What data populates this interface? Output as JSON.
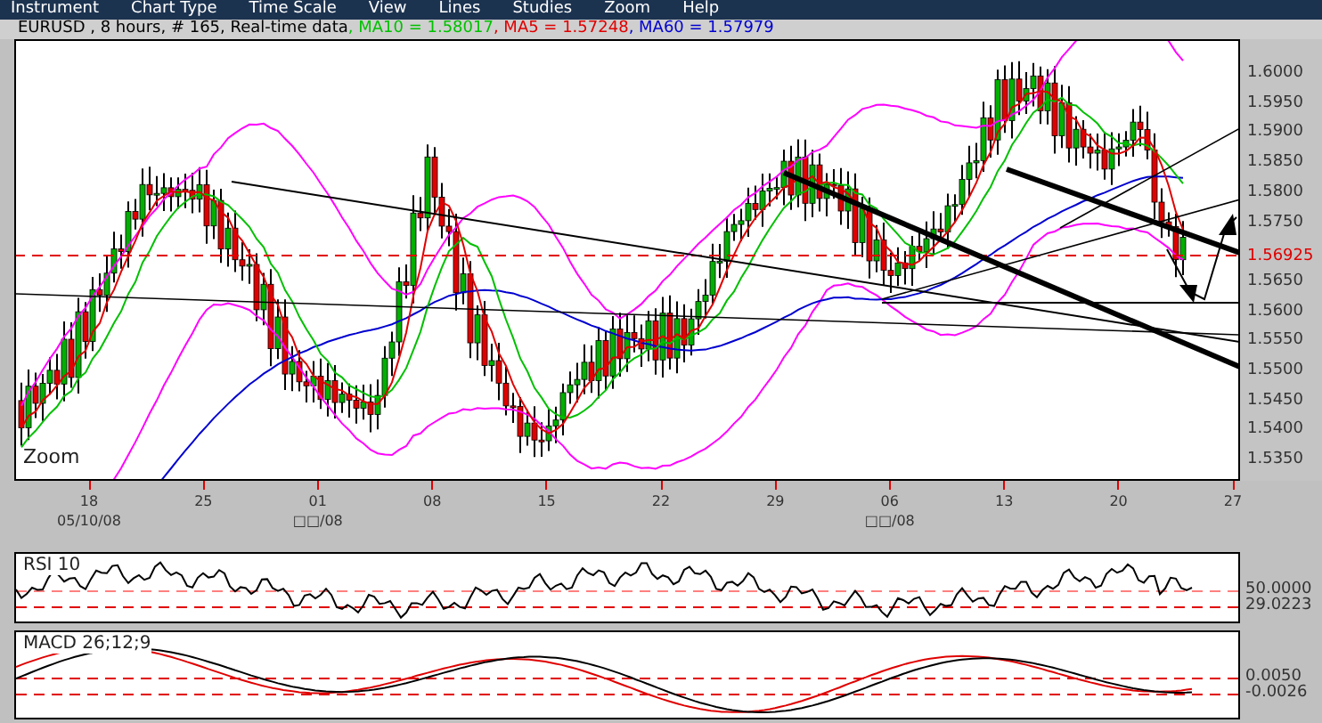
{
  "menu": [
    {
      "label": "Instrument"
    },
    {
      "label": "Chart Type"
    },
    {
      "label": "Time Scale"
    },
    {
      "label": "View"
    },
    {
      "label": "Lines"
    },
    {
      "label": "Studies"
    },
    {
      "label": "Zoom"
    },
    {
      "label": "Help"
    }
  ],
  "legend": [
    {
      "text": "EURUSD , 8 hours, # 165, Real-time data",
      "color": "#000000"
    },
    {
      "text": ", MA10 = 1.58017",
      "color": "#00c000"
    },
    {
      "text": ", MA5 = 1.57248",
      "color": "#e00000"
    },
    {
      "text": ", MA60 = 1.57979",
      "color": "#0000d0"
    }
  ],
  "price_chart": {
    "zoom_label": "Zoom",
    "price_axis": [
      {
        "label": "1.6000",
        "kind": "tick"
      },
      {
        "label": "1.5950",
        "kind": "tick"
      },
      {
        "label": "1.5900",
        "kind": "tick"
      },
      {
        "label": "1.5850",
        "kind": "tick"
      },
      {
        "label": "1.5800",
        "kind": "tick"
      },
      {
        "label": "1.5750",
        "kind": "tick"
      },
      {
        "label": "1.56925",
        "kind": "current"
      },
      {
        "label": "1.5650",
        "kind": "tick"
      },
      {
        "label": "1.5600",
        "kind": "tick"
      },
      {
        "label": "1.5550",
        "kind": "tick"
      },
      {
        "label": "1.5500",
        "kind": "tick"
      },
      {
        "label": "1.5450",
        "kind": "tick"
      },
      {
        "label": "1.5400",
        "kind": "tick"
      },
      {
        "label": "1.5350",
        "kind": "tick"
      }
    ]
  },
  "date_axis": [
    {
      "day": "18",
      "month": "05/10/08"
    },
    {
      "day": "25"
    },
    {
      "day": "01",
      "month": "□□/08"
    },
    {
      "day": "08"
    },
    {
      "day": "15"
    },
    {
      "day": "22"
    },
    {
      "day": "29"
    },
    {
      "day": "06",
      "month": "□□/08"
    },
    {
      "day": "13"
    },
    {
      "day": "20"
    },
    {
      "day": "27"
    }
  ],
  "rsi": {
    "title": "RSI 10",
    "levels": [
      {
        "label": "50.0000",
        "kind": "tick"
      },
      {
        "label": "29.0223",
        "kind": "current"
      }
    ]
  },
  "macd": {
    "title": "MACD 26;12;9",
    "levels": [
      {
        "label": "0.0050",
        "kind": "tick"
      },
      {
        "label": "-0.0026",
        "kind": "current"
      }
    ]
  }
}
